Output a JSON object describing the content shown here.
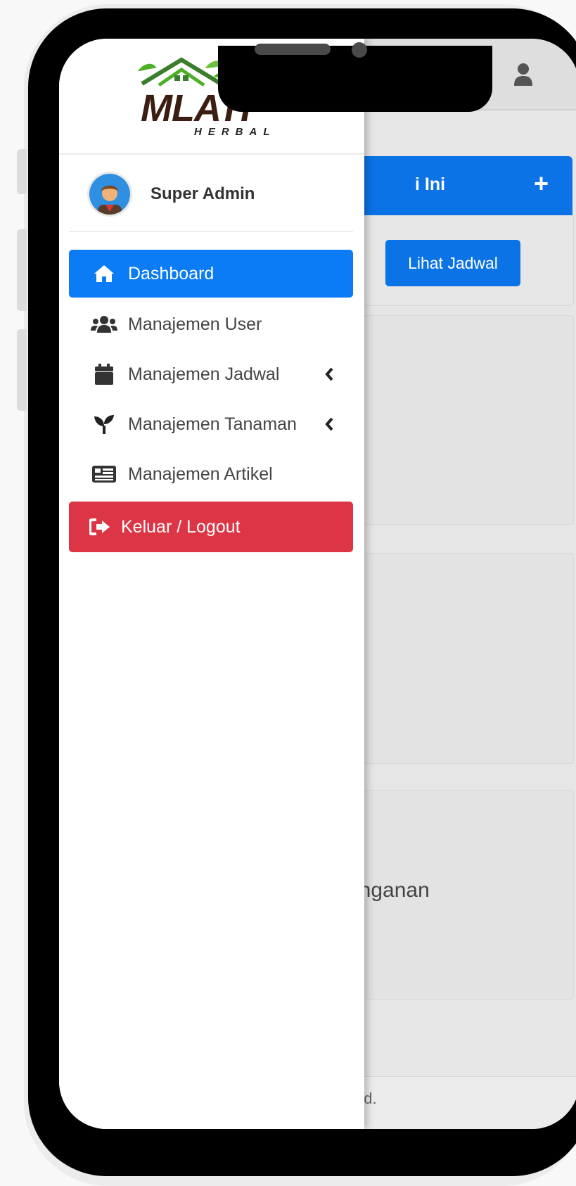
{
  "app": {
    "brand_name": "MLATI",
    "brand_sub": "HERBAL"
  },
  "topbar": {
    "user_icon": "user-icon"
  },
  "sidebar": {
    "user": {
      "name": "Super Admin",
      "avatar_icon": "user-avatar-icon"
    },
    "items": [
      {
        "label": "Dashboard",
        "icon": "home-icon",
        "active": true
      },
      {
        "label": "Manajemen User",
        "icon": "users-icon"
      },
      {
        "label": "Manajemen Jadwal",
        "icon": "calendar-icon",
        "has_submenu": true
      },
      {
        "label": "Manajemen Tanaman",
        "icon": "seedling-icon",
        "has_submenu": true
      },
      {
        "label": "Manajemen Artikel",
        "icon": "newspaper-icon"
      }
    ],
    "logout_label": "Keluar / Logout"
  },
  "main": {
    "card_title_fragment": "i Ini",
    "card_add": "+",
    "view_schedule_button": "Lihat Jadwal",
    "panel_text_fragment": "anganan",
    "footer_fragment": "ved."
  },
  "colors": {
    "primary": "#0b7cf5",
    "danger": "#dc3545",
    "brand_brown": "#3b1d12",
    "brand_green": "#4caf24"
  }
}
